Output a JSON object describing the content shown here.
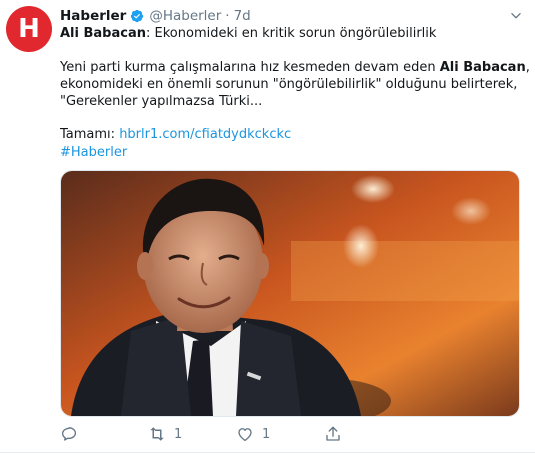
{
  "tweet": {
    "avatar_letter": "H",
    "display_name": "Haberler",
    "handle": "@Haberler",
    "dot": "·",
    "time": "7d",
    "headline_bold": "Ali Babacan",
    "headline_rest": ": Ekonomideki en kritik sorun öngörülebilirlik",
    "p1_a": "Yeni parti kurma çalışmalarına hız kesmeden devam eden ",
    "p1_bold": "Ali Babacan",
    "p1_b": ",",
    "p2": "ekonomideki en önemli sorunun \"öngörülebilirlik\" olduğunu belirterek,",
    "p3": "\"Gerekenler yapılmazsa Türki...",
    "more_label": "Tamamı: ",
    "more_link": "hbrlr1.com/cfiatdydkckckc",
    "hashtag": "#Haberler"
  },
  "actions": {
    "reply_count": "",
    "retweet_count": "1",
    "like_count": "1",
    "share_count": ""
  },
  "icons": {
    "verified": "verified-badge-icon",
    "menu": "chevron-down-icon",
    "reply": "reply-icon",
    "retweet": "retweet-icon",
    "like": "heart-icon",
    "share": "share-icon"
  },
  "colors": {
    "brand_red": "#e0282e",
    "link_blue": "#1b95e0",
    "muted": "#657786"
  }
}
